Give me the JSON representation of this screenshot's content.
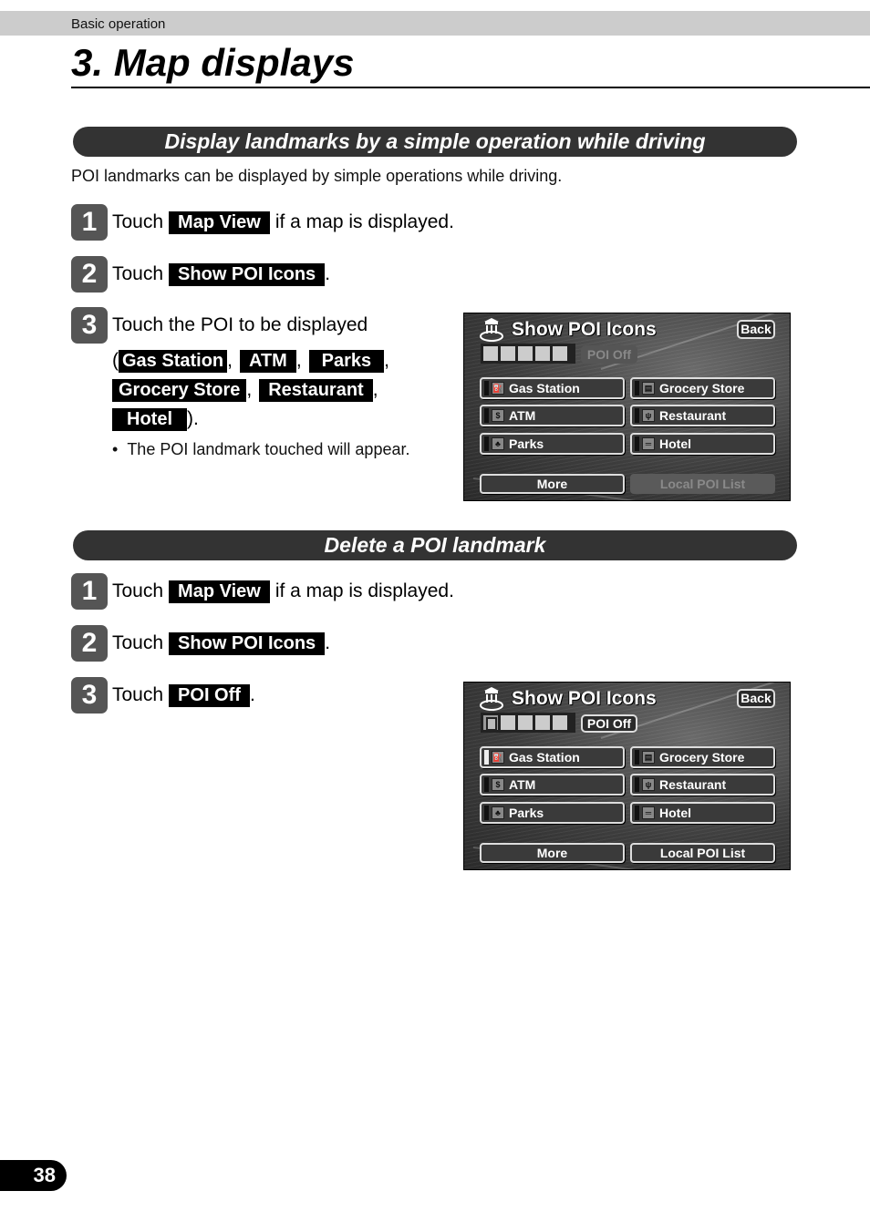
{
  "header": {
    "section": "Basic operation"
  },
  "page": {
    "title": "3. Map displays",
    "number": "38"
  },
  "section1": {
    "title": "Display landmarks by a simple operation while driving",
    "intro": "POI landmarks can be displayed by simple operations while driving.",
    "steps": [
      {
        "num": "1",
        "before": "Touch",
        "button": "Map View",
        "after": "if a map is displayed."
      },
      {
        "num": "2",
        "before": "Touch",
        "button": "Show POI Icons",
        "after": "."
      },
      {
        "num": "3",
        "before": "Touch the POI to be displayed"
      }
    ],
    "poi_options": [
      "Gas Station",
      "ATM",
      "Parks",
      "Grocery Store",
      "Restaurant",
      "Hotel"
    ],
    "punct": {
      "open": "(",
      "comma": ",",
      "close": ")."
    },
    "note": "The POI landmark touched will appear.",
    "screen": {
      "title": "Show POI Icons",
      "back": "Back",
      "poi_off": "POI Off",
      "poi_off_enabled": false,
      "buttons": [
        "Gas Station",
        "Grocery Store",
        "ATM",
        "Restaurant",
        "Parks",
        "Hotel"
      ],
      "more": "More",
      "local_list": "Local POI List",
      "local_list_enabled": false
    }
  },
  "section2": {
    "title": "Delete a POI landmark",
    "steps": [
      {
        "num": "1",
        "before": "Touch",
        "button": "Map View",
        "after": "if a map is displayed."
      },
      {
        "num": "2",
        "before": "Touch",
        "button": "Show POI Icons",
        "after": "."
      },
      {
        "num": "3",
        "before": "Touch",
        "button": "POI Off",
        "after": "."
      }
    ],
    "screen": {
      "title": "Show POI Icons",
      "back": "Back",
      "poi_off": "POI Off",
      "poi_off_enabled": true,
      "buttons": [
        "Gas Station",
        "Grocery Store",
        "ATM",
        "Restaurant",
        "Parks",
        "Hotel"
      ],
      "more": "More",
      "local_list": "Local POI List",
      "local_list_enabled": true
    }
  }
}
